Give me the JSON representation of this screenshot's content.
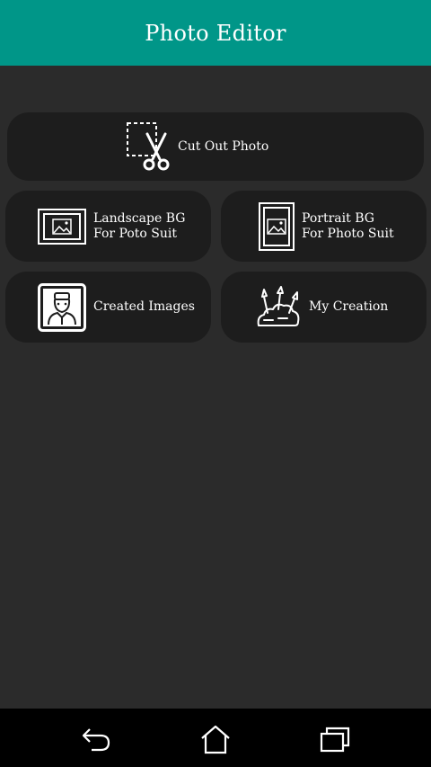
{
  "app": {
    "title": "Photo Editor"
  },
  "menu": {
    "cut_out": {
      "label": "Cut Out Photo",
      "icon": "scissors-crop-icon"
    },
    "landscape_bg": {
      "line1": "Landscape BG",
      "line2": "For Poto Suit",
      "icon": "landscape-frame-icon"
    },
    "portrait_bg": {
      "line1": "Portrait BG",
      "line2": "For Photo Suit",
      "icon": "portrait-frame-icon"
    },
    "created_images": {
      "label": "Created Images",
      "icon": "person-portrait-icon"
    },
    "my_creation": {
      "label": "My Creation",
      "icon": "paint-brushes-icon"
    }
  },
  "navbar": {
    "back_icon": "back-arrow-icon",
    "home_icon": "home-icon",
    "recents_icon": "recent-apps-icon"
  },
  "colors": {
    "appbar": "#009688",
    "background": "#2b2b2b",
    "card": "#1d1d1d",
    "navbar": "#000000"
  }
}
